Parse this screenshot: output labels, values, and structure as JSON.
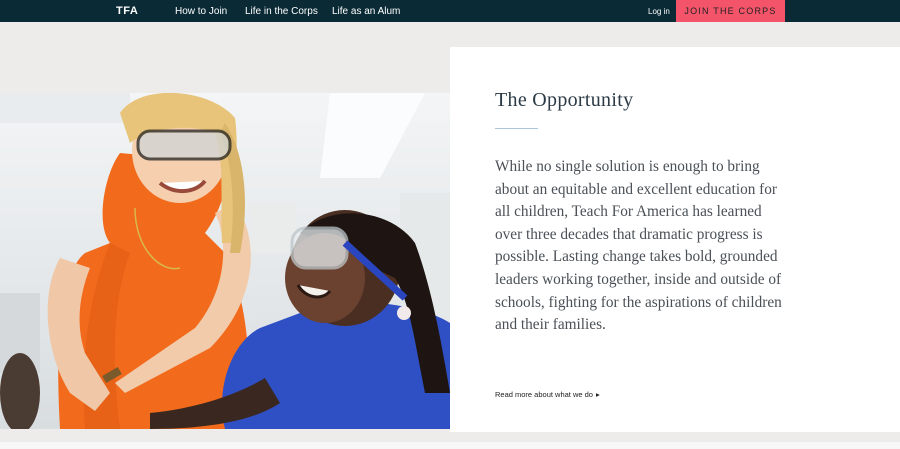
{
  "nav": {
    "logo": "TFA",
    "links": [
      "How to Join",
      "Life in the Corps",
      "Life as an Alum"
    ],
    "login": "Log in",
    "cta": "JOIN THE CORPS"
  },
  "section": {
    "title": "The Opportunity",
    "paragraph": "While no single solution is enough to bring about an equitable and excellent education for all children, Teach For America has learned over three decades that dramatic progress is possible. Lasting change takes bold, grounded leaders working together, inside and outside of schools, fighting for the aspirations of children and their families.",
    "read_more": "Read more about what we do",
    "read_more_icon": "caret-right-icon"
  },
  "colors": {
    "nav_bg": "#0a2a35",
    "cta_bg": "#f4546a",
    "band_bg": "#eeeceb",
    "title": "#2b3a45",
    "body_text": "#4a5056",
    "divider": "#a9c6da"
  }
}
